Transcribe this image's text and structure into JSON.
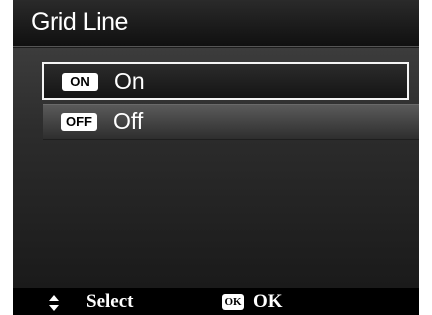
{
  "header": {
    "title": "Grid Line"
  },
  "menu": {
    "options": [
      {
        "badge": "ON",
        "label": "On",
        "selected": true
      },
      {
        "badge": "OFF",
        "label": "Off",
        "selected": false
      }
    ]
  },
  "footer": {
    "select_icon": "up-down-arrows-icon",
    "select_label": "Select",
    "ok_icon_text": "OK",
    "ok_label": "OK"
  },
  "colors": {
    "background": "#1c1c1c",
    "text": "#ffffff",
    "selection_border": "#f4f4f4",
    "footer": "#000000"
  }
}
